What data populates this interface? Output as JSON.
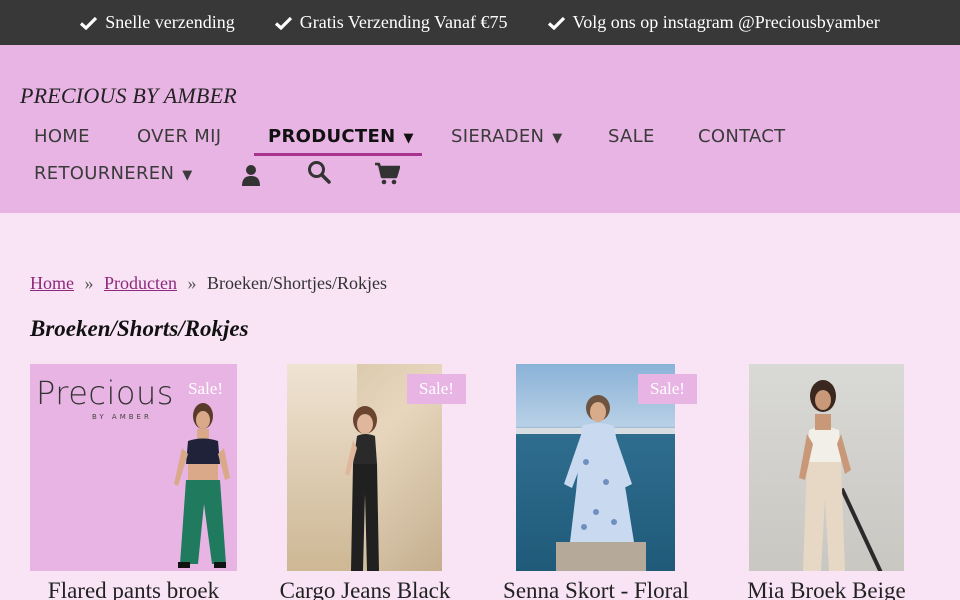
{
  "topbar": {
    "items": [
      {
        "icon": "check-icon",
        "text": "Snelle verzending"
      },
      {
        "icon": "check-icon",
        "text": "Gratis Verzending Vanaf €75"
      },
      {
        "icon": "check-icon",
        "text": "Volg ons op instagram @Preciousbyamber"
      }
    ]
  },
  "header": {
    "logo": "PRECIOUS BY AMBER",
    "nav": {
      "home": "HOME",
      "over_mij": "OVER MIJ",
      "producten": "PRODUCTEN",
      "sieraden": "SIERADEN",
      "sale": "SALE",
      "contact": "CONTACT",
      "retourneren": "RETOURNEREN",
      "caret": "▼"
    },
    "icons": [
      "user-icon",
      "search-icon",
      "cart-icon"
    ]
  },
  "breadcrumb": {
    "home": "Home",
    "producten": "Producten",
    "current": "Broeken/Shortjes/Rokjes",
    "separator": "»"
  },
  "page_title": "Broeken/Shorts/Rokjes",
  "products": [
    {
      "name": "Flared pants broek",
      "sale": "Sale!",
      "image_text": "Precious",
      "image_subtext": "BY AMBER"
    },
    {
      "name": "Cargo Jeans Black",
      "sale": "Sale!"
    },
    {
      "name": "Senna Skort - Floral",
      "sale": "Sale!"
    },
    {
      "name": "Mia Broek Beige"
    }
  ],
  "colors": {
    "topbar": "#383838",
    "header": "#e8b4e3",
    "page": "#f8e4f5",
    "accent": "#a8348f",
    "sale": "#e8b4e3"
  }
}
